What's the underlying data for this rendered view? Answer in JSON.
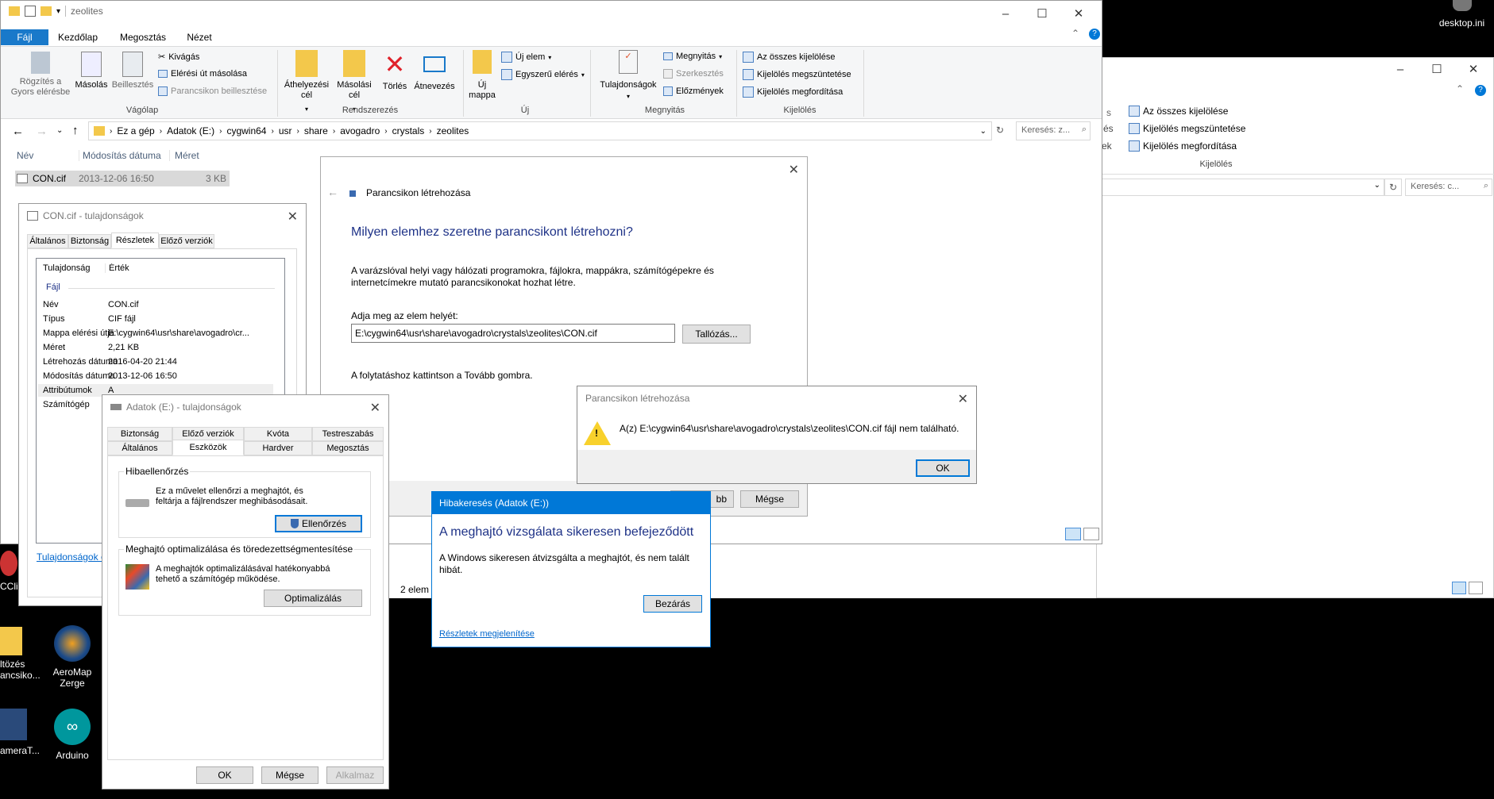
{
  "desktop": {
    "top_right_icon": "desktop.ini",
    "icons": [
      {
        "label": "ltözés\nancsiko..."
      },
      {
        "label": "AeroMap Zerge"
      },
      {
        "label": "ameraT..."
      },
      {
        "label": "Arduino"
      },
      {
        "label": "CCli"
      }
    ]
  },
  "explorer": {
    "title": "zeolites",
    "menu_tabs": [
      "Fájl",
      "Kezdőlap",
      "Megosztás",
      "Nézet"
    ],
    "ribbon": {
      "pin": "Rögzítés a Gyors elérésbe",
      "copy": "Másolás",
      "paste": "Beillesztés",
      "cut": "Kivágás",
      "copy_path": "Elérési út másolása",
      "paste_shortcut": "Parancsikon beillesztése",
      "clipboard_group": "Vágólap",
      "move_to": "Áthelyezési cél",
      "copy_to": "Másolási cél",
      "delete": "Törlés",
      "rename": "Átnevezés",
      "organize_group": "Rendszerezés",
      "new_folder": "Új mappa",
      "new_item": "Új elem",
      "easy_access": "Egyszerű elérés",
      "new_group": "Új",
      "properties": "Tulajdonságok",
      "open": "Megnyitás",
      "edit": "Szerkesztés",
      "history": "Előzmények",
      "open_group": "Megnyitás",
      "select_all": "Az összes kijelölése",
      "select_none": "Kijelölés megszüntetése",
      "invert": "Kijelölés megfordítása",
      "select_group": "Kijelölés"
    },
    "breadcrumb": [
      "Ez a gép",
      "Adatok (E:)",
      "cygwin64",
      "usr",
      "share",
      "avogadro",
      "crystals",
      "zeolites"
    ],
    "search_placeholder": "Keresés: z...",
    "columns": [
      "Név",
      "Módosítás dátuma",
      "Méret"
    ],
    "files": [
      {
        "name": "CON.cif",
        "date": "2013-12-06 16:50",
        "size": "3 KB"
      }
    ],
    "status": "2 elem"
  },
  "explorer2": {
    "select_all": "Az összes kijelölése",
    "select_none": "Kijelölés megszüntetése",
    "invert": "Kijelölés megfordítása",
    "select_group": "Kijelölés",
    "search_placeholder": "Keresés: c...",
    "frag1": "s",
    "frag2": "és",
    "frag3": "ek"
  },
  "props": {
    "title": "CON.cif - tulajdonságok",
    "tabs": [
      "Általános",
      "Biztonság",
      "Részletek",
      "Előző verziók"
    ],
    "header": {
      "prop": "Tulajdonság",
      "val": "Érték"
    },
    "section": "Fájl",
    "rows": [
      {
        "k": "Név",
        "v": "CON.cif"
      },
      {
        "k": "Típus",
        "v": "CIF fájl"
      },
      {
        "k": "Mappa elérési útja",
        "v": "E:\\cygwin64\\usr\\share\\avogadro\\cr..."
      },
      {
        "k": "Méret",
        "v": "2,21 KB"
      },
      {
        "k": "Létrehozás dátuma",
        "v": "2016-04-20 21:44"
      },
      {
        "k": "Módosítás dátuma",
        "v": "2013-12-06 16:50"
      },
      {
        "k": "Attribútumok",
        "v": "A"
      },
      {
        "k": "Számítógép",
        "v": ""
      }
    ],
    "link": "Tulajdonságok és"
  },
  "shortcut_wizard": {
    "title": "Parancsikon létrehozása",
    "heading": "Milyen elemhez szeretne parancsikont létrehozni?",
    "desc": "A varázslóval helyi vagy hálózati programokra, fájlokra, mappákra, számítógépekre és internetcímekre mutató parancsikonokat hozhat létre.",
    "location_label": "Adja meg az elem helyét:",
    "location_value": "E:\\cygwin64\\usr\\share\\avogadro\\crystals\\zeolites\\CON.cif",
    "browse": "Tallózás...",
    "hint": "A folytatáshoz kattintson a Tovább gombra.",
    "next": "bb",
    "cancel": "Mégse"
  },
  "error_dialog": {
    "title": "Parancsikon létrehozása",
    "message": "A(z) E:\\cygwin64\\usr\\share\\avogadro\\crystals\\zeolites\\CON.cif fájl nem található.",
    "ok": "OK"
  },
  "drive_props": {
    "title": "Adatok (E:) - tulajdonságok",
    "tabs_row1": [
      "Biztonság",
      "Előző verziók",
      "Kvóta",
      "Testreszabás"
    ],
    "tabs_row2": [
      "Általános",
      "Eszközök",
      "Hardver",
      "Megosztás"
    ],
    "check_group": "Hibaellenőrzés",
    "check_text": "Ez a művelet ellenőrzi a meghajtót, és feltárja a fájlrendszer meghibásodásait.",
    "check_btn": "Ellenőrzés",
    "opt_group": "Meghajtó optimalizálása és töredezettségmentesítése",
    "opt_text": "A meghajtók optimalizálásával hatékonyabbá tehető a számítógép működése.",
    "opt_btn": "Optimalizálás",
    "ok": "OK",
    "cancel": "Mégse",
    "apply": "Alkalmaz"
  },
  "scan_dialog": {
    "title": "Hibakeresés (Adatok (E:))",
    "heading": "A meghajtó vizsgálata sikeresen befejeződött",
    "body": "A Windows sikeresen átvizsgálta a meghajtót, és nem talált hibát.",
    "close": "Bezárás",
    "details": "Részletek megjelenítése"
  },
  "colors": {
    "accent": "#0078d7",
    "heading_blue": "#1e3287",
    "title_active": "#0078d7"
  }
}
